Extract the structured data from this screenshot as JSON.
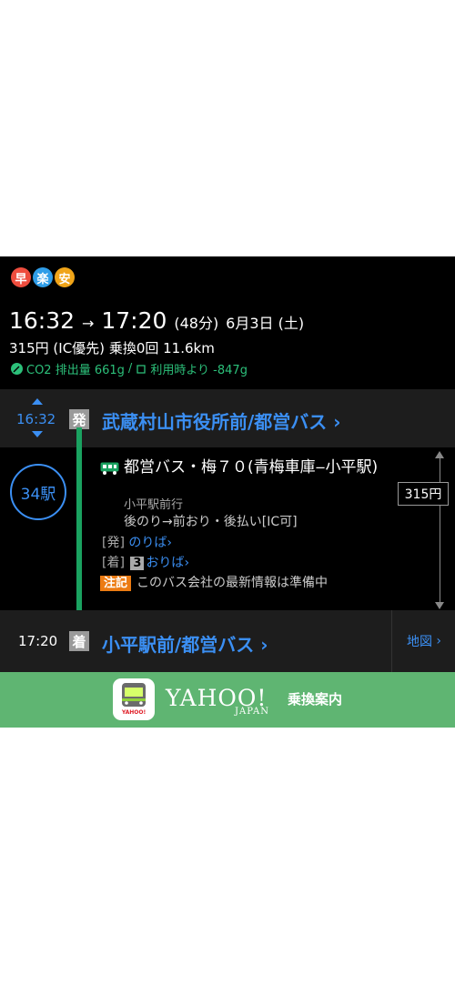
{
  "badges": [
    {
      "label": "早",
      "color": "#ee4d3e"
    },
    {
      "label": "楽",
      "color": "#2f9de8"
    },
    {
      "label": "安",
      "color": "#f0a418"
    }
  ],
  "summary": {
    "depart_time": "16:32",
    "arrow": "→",
    "arrive_time": "17:20",
    "duration": "(48分)",
    "date": "6月3日 (土)",
    "fare": "315円",
    "fare_mode": "(IC優先)",
    "transfer": "乗換0回",
    "distance": "11.6km",
    "co2": "CO2 排出量 661g",
    "co2_compare": "利用時より -847g"
  },
  "departure": {
    "time": "16:32",
    "mark": "発",
    "station": "武蔵村山市役所前/都営バス",
    "chevron": "›"
  },
  "route": {
    "stops": "34駅",
    "line_name": "都営バス・梅７０(青梅車庫‒小平駅)",
    "destination": "小平駅前行",
    "boarding": "後のり→前おり・後払い[IC可]",
    "dep_platform_label": "[発]",
    "dep_platform_link": "のりば",
    "arr_platform_label": "[着]",
    "arr_platform_num": "3",
    "arr_platform_link": "おりば",
    "notice_tag": "注記",
    "notice_text": "このバス会社の最新情報は準備中",
    "fare": "315円"
  },
  "arrival": {
    "time": "17:20",
    "mark": "着",
    "station": "小平駅前/都営バス",
    "map_label": "地図"
  },
  "footer": {
    "brand": "YAHOO!",
    "sub": "JAPAN",
    "service": "乗換案内",
    "icon_text": "YAHOO!"
  }
}
